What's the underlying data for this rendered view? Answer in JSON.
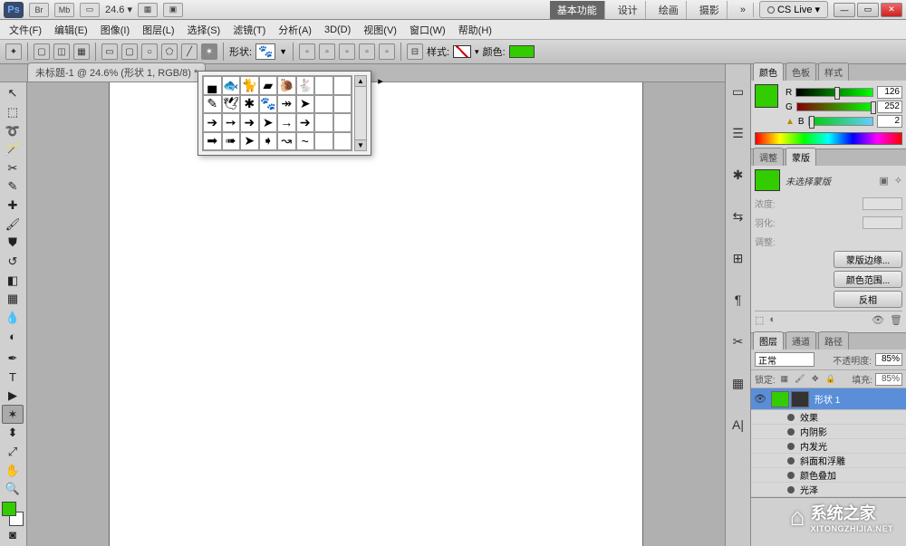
{
  "app": {
    "logo": "Ps",
    "zoom": "24.6"
  },
  "workspaces": {
    "basic": "基本功能",
    "design": "设计",
    "paint": "绘画",
    "photo": "摄影",
    "more": "»",
    "cslive": "CS Live"
  },
  "menu": {
    "file": "文件(F)",
    "edit": "编辑(E)",
    "image": "图像(I)",
    "layer": "图层(L)",
    "select": "选择(S)",
    "filter": "滤镜(T)",
    "analyze": "分析(A)",
    "threeD": "3D(D)",
    "view": "视图(V)",
    "window": "窗口(W)",
    "help": "帮助(H)"
  },
  "options": {
    "shape_label": "形状:",
    "shape_glyph": "🐾",
    "style_label": "样式:",
    "color_label": "颜色:"
  },
  "doc": {
    "tab": "未标题-1 @ 24.6% (形状 1, RGB/8) *"
  },
  "shape_picker": {
    "rows": [
      [
        "▄",
        "🐟",
        "🐈",
        "▰",
        "🐌",
        "🐇",
        "",
        ""
      ],
      [
        "✎",
        "🕊",
        "✱",
        "🐾",
        "↠",
        "➤",
        "",
        ""
      ],
      [
        "➔",
        "➙",
        "➜",
        "➤",
        "→",
        "➔",
        "",
        ""
      ],
      [
        "➡",
        "➠",
        "➤",
        "➧",
        "↝",
        "~",
        "",
        ""
      ]
    ]
  },
  "color_panel": {
    "tabs": {
      "color": "颜色",
      "swatches": "色板",
      "styles": "样式"
    },
    "r_label": "R",
    "r_val": "126",
    "g_label": "G",
    "g_val": "252",
    "b_label": "B",
    "b_val": "2"
  },
  "mask_panel": {
    "tabs": {
      "adjust": "调整",
      "mask": "蒙版"
    },
    "no_mask": "未选择蒙版",
    "density": "浓度:",
    "feather": "羽化:",
    "refine": "调整:",
    "btn_edge": "蒙版边缘...",
    "btn_range": "颜色范围...",
    "btn_invert": "反相"
  },
  "layers_panel": {
    "tabs": {
      "layers": "图层",
      "channels": "通道",
      "paths": "路径"
    },
    "blend": "正常",
    "opacity_label": "不透明度:",
    "opacity": "85%",
    "lock_label": "锁定:",
    "fill_label": "填充:",
    "fill": "85%",
    "layer1": "形状 1",
    "fx": "效果",
    "fx_items": [
      "内阴影",
      "内发光",
      "斜面和浮雕",
      "颜色叠加",
      "光泽"
    ]
  },
  "watermark": {
    "title": "系统之家",
    "url": "XITONGZHIJIA.NET"
  }
}
